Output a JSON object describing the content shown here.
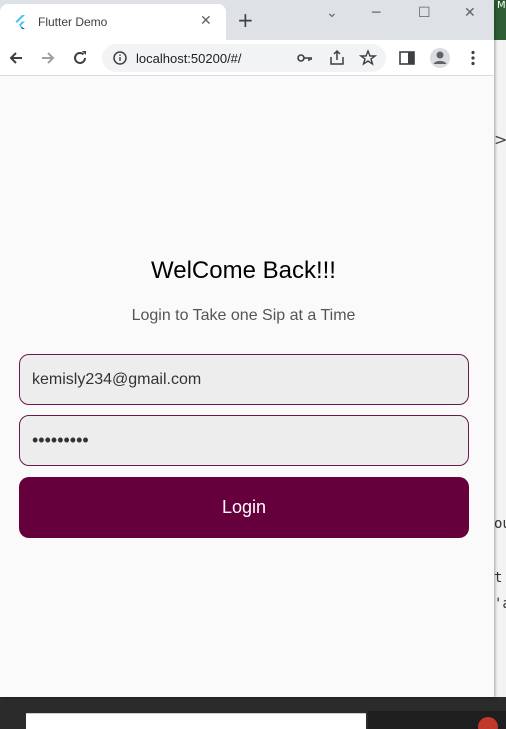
{
  "browser": {
    "tab_title": "Flutter Demo",
    "tab_close": "✕",
    "new_tab": "+",
    "url": "localhost:50200/#/"
  },
  "window_controls": {
    "chevron": "⌄",
    "minimize": "─",
    "maximize": "☐",
    "close": "✕"
  },
  "login": {
    "heading": "WelCome Back!!!",
    "subheading": "Login to Take one Sip at a Time",
    "email_value": "kemisly234@gmail.com",
    "password_value": "•••••••••",
    "login_label": "Login"
  },
  "colors": {
    "primary": "#66003d",
    "field_border": "#6a1a4a",
    "field_bg": "#eeeded",
    "page_bg": "#fafafa"
  },
  "background_fragments": {
    "right_glyph": "M",
    "right_chevron": ">",
    "mono_1": "ou",
    "mono_2": "t",
    "mono_3": "'a"
  }
}
